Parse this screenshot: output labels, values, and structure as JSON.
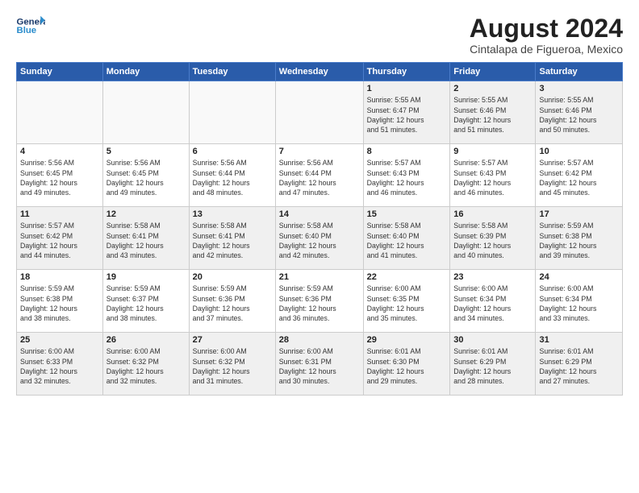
{
  "header": {
    "logo_line1": "General",
    "logo_line2": "Blue",
    "month_year": "August 2024",
    "location": "Cintalapa de Figueroa, Mexico"
  },
  "days_of_week": [
    "Sunday",
    "Monday",
    "Tuesday",
    "Wednesday",
    "Thursday",
    "Friday",
    "Saturday"
  ],
  "weeks": [
    [
      {
        "day": "",
        "info": "",
        "empty": true
      },
      {
        "day": "",
        "info": "",
        "empty": true
      },
      {
        "day": "",
        "info": "",
        "empty": true
      },
      {
        "day": "",
        "info": "",
        "empty": true
      },
      {
        "day": "1",
        "info": "Sunrise: 5:55 AM\nSunset: 6:47 PM\nDaylight: 12 hours\nand 51 minutes."
      },
      {
        "day": "2",
        "info": "Sunrise: 5:55 AM\nSunset: 6:46 PM\nDaylight: 12 hours\nand 51 minutes."
      },
      {
        "day": "3",
        "info": "Sunrise: 5:55 AM\nSunset: 6:46 PM\nDaylight: 12 hours\nand 50 minutes."
      }
    ],
    [
      {
        "day": "4",
        "info": "Sunrise: 5:56 AM\nSunset: 6:45 PM\nDaylight: 12 hours\nand 49 minutes."
      },
      {
        "day": "5",
        "info": "Sunrise: 5:56 AM\nSunset: 6:45 PM\nDaylight: 12 hours\nand 49 minutes."
      },
      {
        "day": "6",
        "info": "Sunrise: 5:56 AM\nSunset: 6:44 PM\nDaylight: 12 hours\nand 48 minutes."
      },
      {
        "day": "7",
        "info": "Sunrise: 5:56 AM\nSunset: 6:44 PM\nDaylight: 12 hours\nand 47 minutes."
      },
      {
        "day": "8",
        "info": "Sunrise: 5:57 AM\nSunset: 6:43 PM\nDaylight: 12 hours\nand 46 minutes."
      },
      {
        "day": "9",
        "info": "Sunrise: 5:57 AM\nSunset: 6:43 PM\nDaylight: 12 hours\nand 46 minutes."
      },
      {
        "day": "10",
        "info": "Sunrise: 5:57 AM\nSunset: 6:42 PM\nDaylight: 12 hours\nand 45 minutes."
      }
    ],
    [
      {
        "day": "11",
        "info": "Sunrise: 5:57 AM\nSunset: 6:42 PM\nDaylight: 12 hours\nand 44 minutes."
      },
      {
        "day": "12",
        "info": "Sunrise: 5:58 AM\nSunset: 6:41 PM\nDaylight: 12 hours\nand 43 minutes."
      },
      {
        "day": "13",
        "info": "Sunrise: 5:58 AM\nSunset: 6:41 PM\nDaylight: 12 hours\nand 42 minutes."
      },
      {
        "day": "14",
        "info": "Sunrise: 5:58 AM\nSunset: 6:40 PM\nDaylight: 12 hours\nand 42 minutes."
      },
      {
        "day": "15",
        "info": "Sunrise: 5:58 AM\nSunset: 6:40 PM\nDaylight: 12 hours\nand 41 minutes."
      },
      {
        "day": "16",
        "info": "Sunrise: 5:58 AM\nSunset: 6:39 PM\nDaylight: 12 hours\nand 40 minutes."
      },
      {
        "day": "17",
        "info": "Sunrise: 5:59 AM\nSunset: 6:38 PM\nDaylight: 12 hours\nand 39 minutes."
      }
    ],
    [
      {
        "day": "18",
        "info": "Sunrise: 5:59 AM\nSunset: 6:38 PM\nDaylight: 12 hours\nand 38 minutes."
      },
      {
        "day": "19",
        "info": "Sunrise: 5:59 AM\nSunset: 6:37 PM\nDaylight: 12 hours\nand 38 minutes."
      },
      {
        "day": "20",
        "info": "Sunrise: 5:59 AM\nSunset: 6:36 PM\nDaylight: 12 hours\nand 37 minutes."
      },
      {
        "day": "21",
        "info": "Sunrise: 5:59 AM\nSunset: 6:36 PM\nDaylight: 12 hours\nand 36 minutes."
      },
      {
        "day": "22",
        "info": "Sunrise: 6:00 AM\nSunset: 6:35 PM\nDaylight: 12 hours\nand 35 minutes."
      },
      {
        "day": "23",
        "info": "Sunrise: 6:00 AM\nSunset: 6:34 PM\nDaylight: 12 hours\nand 34 minutes."
      },
      {
        "day": "24",
        "info": "Sunrise: 6:00 AM\nSunset: 6:34 PM\nDaylight: 12 hours\nand 33 minutes."
      }
    ],
    [
      {
        "day": "25",
        "info": "Sunrise: 6:00 AM\nSunset: 6:33 PM\nDaylight: 12 hours\nand 32 minutes."
      },
      {
        "day": "26",
        "info": "Sunrise: 6:00 AM\nSunset: 6:32 PM\nDaylight: 12 hours\nand 32 minutes."
      },
      {
        "day": "27",
        "info": "Sunrise: 6:00 AM\nSunset: 6:32 PM\nDaylight: 12 hours\nand 31 minutes."
      },
      {
        "day": "28",
        "info": "Sunrise: 6:00 AM\nSunset: 6:31 PM\nDaylight: 12 hours\nand 30 minutes."
      },
      {
        "day": "29",
        "info": "Sunrise: 6:01 AM\nSunset: 6:30 PM\nDaylight: 12 hours\nand 29 minutes."
      },
      {
        "day": "30",
        "info": "Sunrise: 6:01 AM\nSunset: 6:29 PM\nDaylight: 12 hours\nand 28 minutes."
      },
      {
        "day": "31",
        "info": "Sunrise: 6:01 AM\nSunset: 6:29 PM\nDaylight: 12 hours\nand 27 minutes."
      }
    ]
  ]
}
